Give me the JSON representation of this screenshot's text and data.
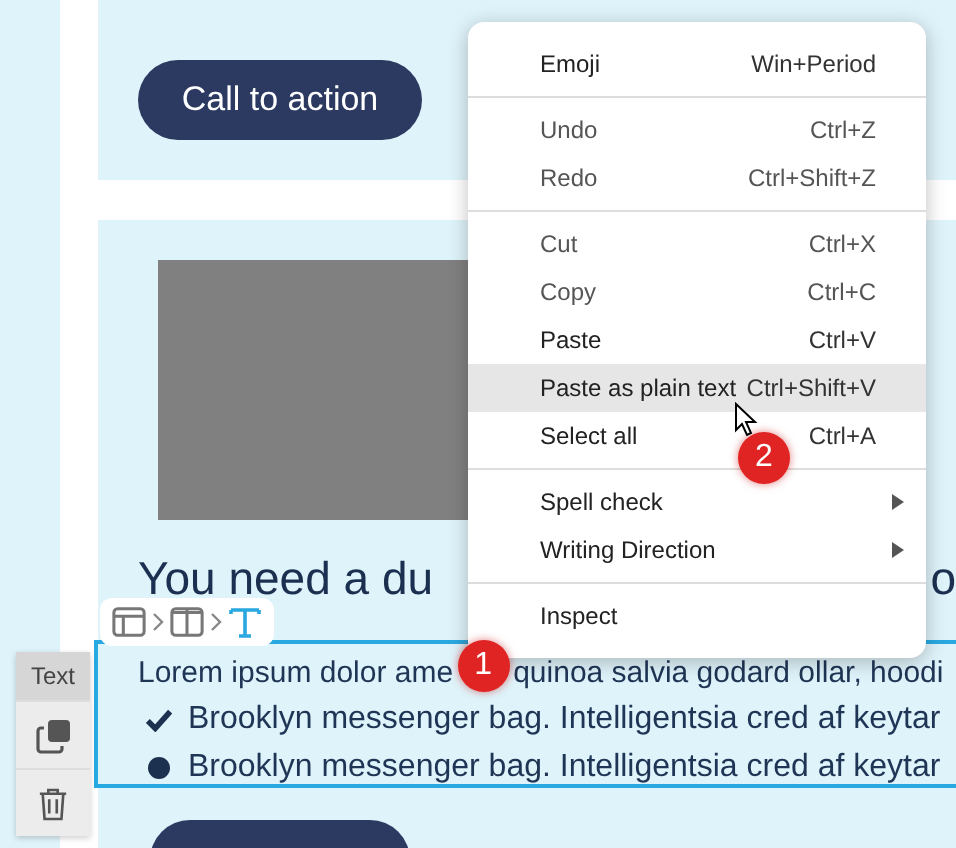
{
  "cta_button": "Call to action",
  "heading": {
    "left": "You need a du",
    "right": "o"
  },
  "breadcrumb": [
    {
      "kind": "layout",
      "selected": false
    },
    {
      "kind": "columns",
      "selected": false
    },
    {
      "kind": "text",
      "selected": true
    }
  ],
  "block_toolbar": {
    "label": "Text"
  },
  "text_block": {
    "selected": true,
    "paragraph": [
      "Lorem ipsum dolor ame",
      "quinoa salvia godard ollar, hoodi"
    ],
    "list": [
      {
        "kind": "check",
        "text": "Brooklyn messenger bag. Intelligentsia cred af keytar"
      },
      {
        "kind": "bullet",
        "text": "Brooklyn messenger bag. Intelligentsia cred af keytar"
      }
    ]
  },
  "context_menu": {
    "groups": [
      [
        {
          "label": "Emoji",
          "shortcut": "Win+Period",
          "kind": "item",
          "disabled": false,
          "selected": false
        }
      ],
      [
        {
          "label": "Undo",
          "shortcut": "Ctrl+Z",
          "kind": "item",
          "disabled": true,
          "selected": false
        },
        {
          "label": "Redo",
          "shortcut": "Ctrl+Shift+Z",
          "kind": "item",
          "disabled": true,
          "selected": false
        }
      ],
      [
        {
          "label": "Cut",
          "shortcut": "Ctrl+X",
          "kind": "item",
          "disabled": true,
          "selected": false
        },
        {
          "label": "Copy",
          "shortcut": "Ctrl+C",
          "kind": "item",
          "disabled": true,
          "selected": false
        },
        {
          "label": "Paste",
          "shortcut": "Ctrl+V",
          "kind": "item",
          "disabled": false,
          "selected": false
        },
        {
          "label": "Paste as plain text",
          "shortcut": "Ctrl+Shift+V",
          "kind": "item",
          "disabled": false,
          "selected": true
        },
        {
          "label": "Select all",
          "shortcut": "Ctrl+A",
          "kind": "item",
          "disabled": false,
          "selected": false
        }
      ],
      [
        {
          "label": "Spell check",
          "kind": "submenu",
          "disabled": false,
          "selected": false
        },
        {
          "label": "Writing Direction",
          "kind": "submenu",
          "disabled": false,
          "selected": false
        }
      ],
      [
        {
          "label": "Inspect",
          "kind": "item",
          "disabled": false,
          "selected": false
        }
      ]
    ]
  },
  "step_badges": [
    "1",
    "2"
  ]
}
